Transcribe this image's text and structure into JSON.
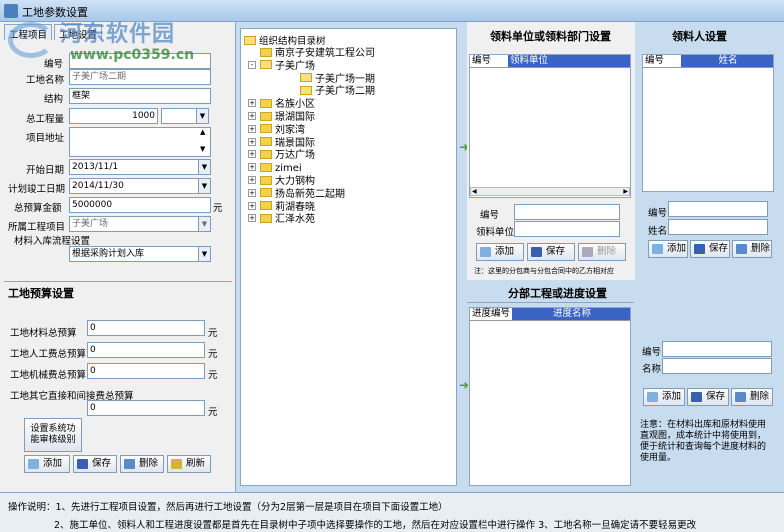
{
  "window": {
    "title": "工地参数设置"
  },
  "watermark": {
    "name": "河东软件园",
    "url": "www.pc0359.cn"
  },
  "tabs": [
    {
      "label": "工程项目"
    },
    {
      "label": "工地设置"
    }
  ],
  "site_form": {
    "code_label": "编号",
    "code_value": "",
    "name_label": "工地名称",
    "name_value": "子美广场二期",
    "structure_label": "结构",
    "structure_value": "框架",
    "total_label": "总工程量",
    "total_value": "1000",
    "unit_value": "",
    "address_label": "项目地址",
    "address_value": "",
    "start_label": "开始日期",
    "start_value": "2013/11/1",
    "end_label": "计划竣工日期",
    "end_value": "2014/11/30",
    "budget_label": "总预算金额",
    "budget_value": "5000000",
    "budget_unit": "元",
    "project_label": "所属工程项目",
    "project_value": "子美广场",
    "flow_label": "材料入库流程设置",
    "flow_value": "根据采购计划入库"
  },
  "budget": {
    "title": "工地预算设置",
    "rows": [
      {
        "label": "工地材料总预算",
        "value": "0",
        "unit": "元"
      },
      {
        "label": "工地人工费总预算",
        "value": "0",
        "unit": "元"
      },
      {
        "label": "工地机械费总预算",
        "value": "0",
        "unit": "元"
      },
      {
        "label": "工地其它直接和间接费总预算",
        "value": "0",
        "unit": "元"
      }
    ],
    "audit_button": "设置系统功能审核级别",
    "buttons": {
      "add": "添加",
      "save": "保存",
      "delete": "删除",
      "refresh": "刷新"
    }
  },
  "tree": {
    "root": "组织结构目录树",
    "nodes": [
      {
        "label": "南京子安建筑工程公司",
        "level": 2,
        "expander": "",
        "open": false
      },
      {
        "label": "子美广场",
        "level": 1,
        "expander": "-",
        "open": true
      },
      {
        "label": "子美广场一期",
        "level": 2,
        "expander": "",
        "open": true
      },
      {
        "label": "子美广场二期",
        "level": 2,
        "expander": "",
        "open": true
      },
      {
        "label": "名族小区",
        "level": 1,
        "expander": "+",
        "open": false
      },
      {
        "label": "璟湖国际",
        "level": 1,
        "expander": "+",
        "open": false
      },
      {
        "label": "刘家湾",
        "level": 1,
        "expander": "+",
        "open": false
      },
      {
        "label": "瑞景国际",
        "level": 1,
        "expander": "+",
        "open": false
      },
      {
        "label": "万达广场",
        "level": 1,
        "expander": "+",
        "open": false
      },
      {
        "label": "zimei",
        "level": 1,
        "expander": "+",
        "open": false
      },
      {
        "label": "大力钢构",
        "level": 1,
        "expander": "+",
        "open": false
      },
      {
        "label": "扬岛新苑二起期",
        "level": 1,
        "expander": "+",
        "open": false
      },
      {
        "label": "莉湖春晓",
        "level": 1,
        "expander": "+",
        "open": false
      },
      {
        "label": "汇泽水苑",
        "level": 1,
        "expander": "+",
        "open": false
      }
    ]
  },
  "material_unit": {
    "title": "领料单位或领料部门设置",
    "columns": [
      "编号",
      "领料单位"
    ],
    "code_label": "编号",
    "unit_label": "领料单位",
    "buttons": {
      "add": "添加",
      "save": "保存",
      "delete": "删除"
    },
    "note": "注：这里的分包商与分包合同中的乙方相对应"
  },
  "material_person": {
    "title": "领料人设置",
    "columns": [
      "编号",
      "姓名"
    ],
    "code_label": "编号",
    "name_label": "姓名",
    "buttons": {
      "add": "添加",
      "save": "保存",
      "delete": "删除"
    }
  },
  "sub_project": {
    "title": "分部工程或进度设置",
    "columns": [
      "进度编号",
      "进度名称"
    ],
    "code_label": "编号",
    "name_label": "名称",
    "buttons": {
      "add": "添加",
      "save": "保存",
      "delete": "删除"
    },
    "note": "注意：在材料出库和原材料使用直观图，成本统计中将使用到，便于统计和查询每个进度材料的使用量。"
  },
  "instructions": {
    "line1": "操作说明：1、先进行工程项目设置，然后再进行工地设置（分为2层第一层是项目在项目下面设置工地）",
    "line2": "2、施工单位、领料人和工程进度设置都是首先在目录树中子项中选择要操作的工地，然后在对应设置栏中进行操作   3、工地名称一旦确定请不要轻易更改"
  },
  "colors": {
    "accent": "#3b63c4",
    "arrow": "#4fa020",
    "folder": "#f2d24b"
  }
}
